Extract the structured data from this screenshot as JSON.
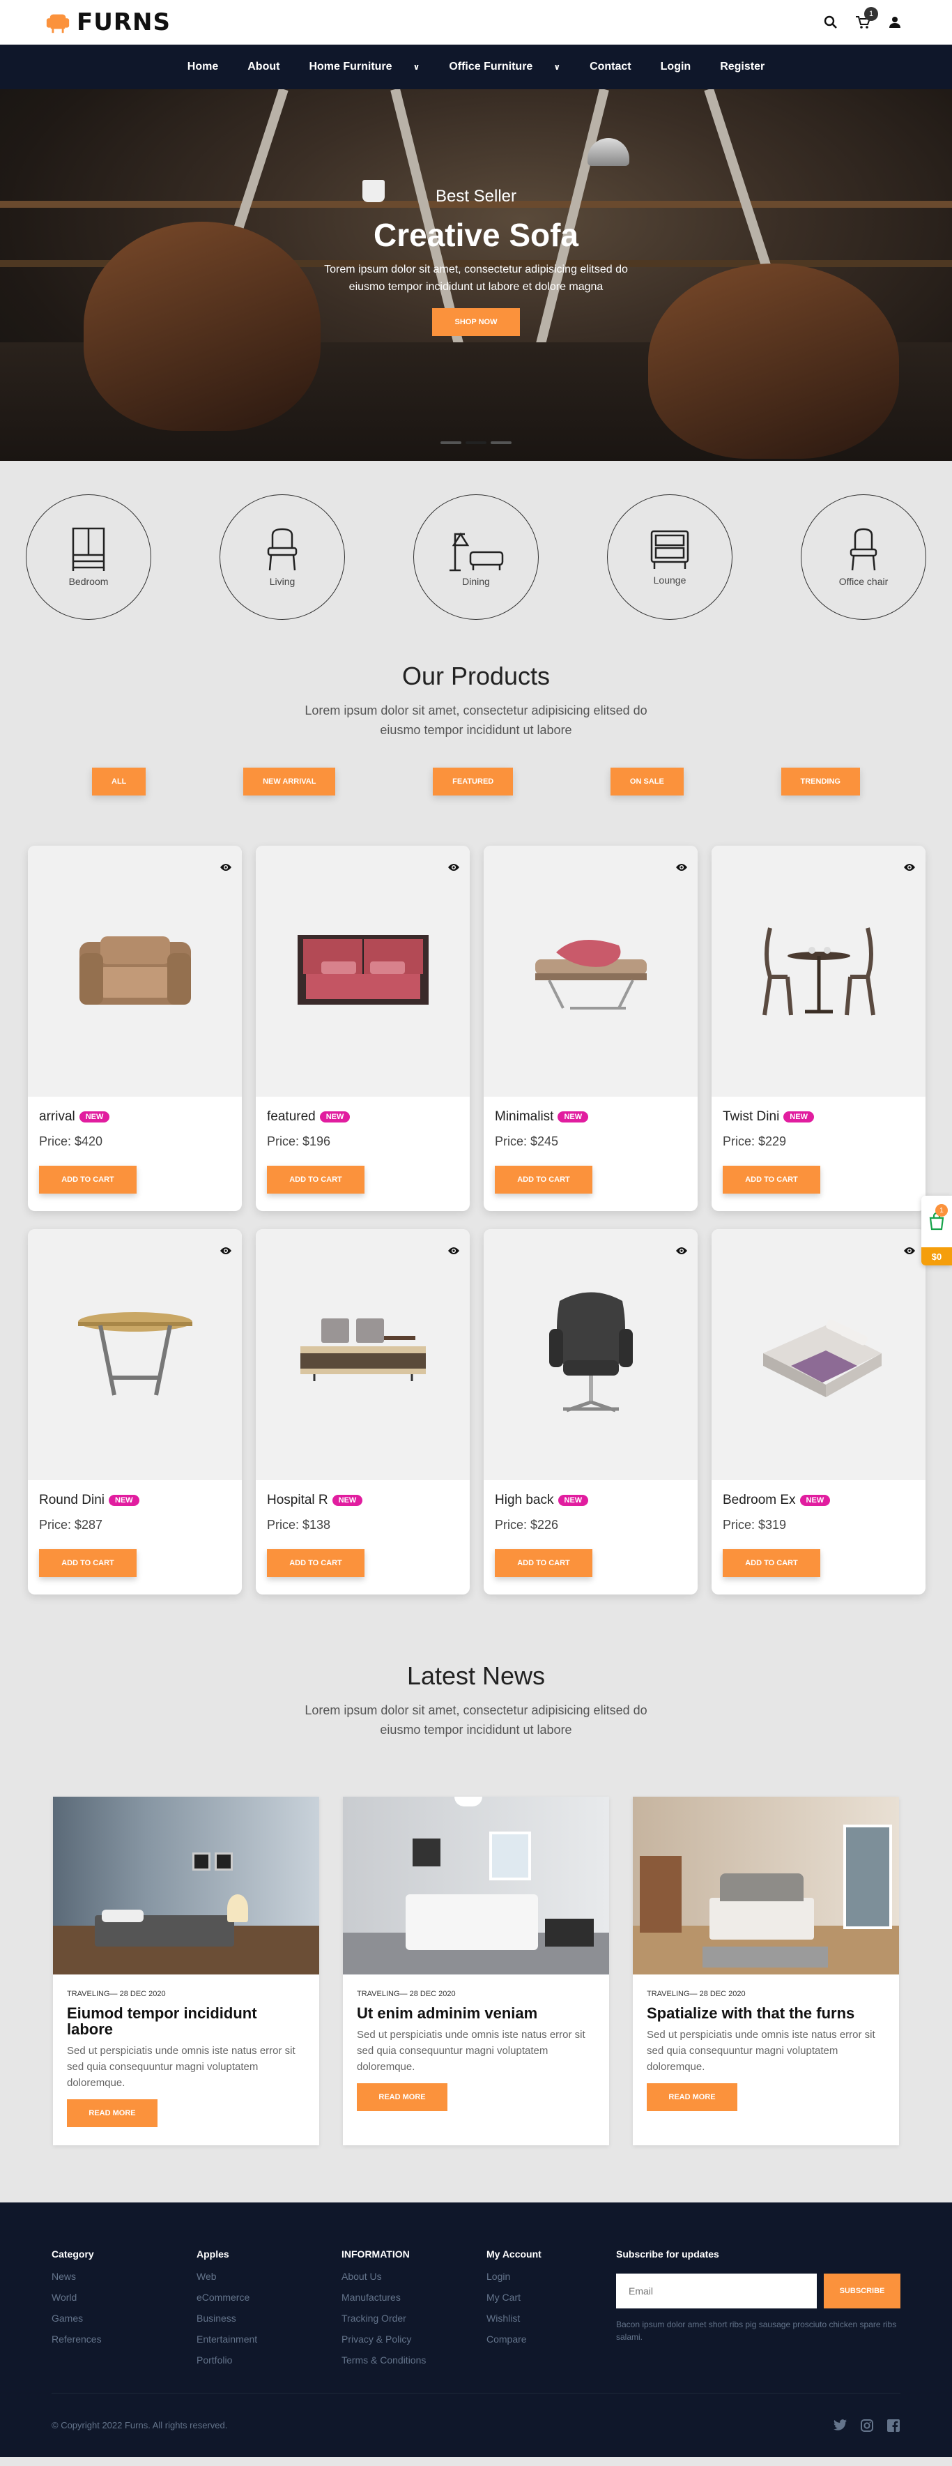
{
  "brand": {
    "name": "FURNS"
  },
  "header": {
    "cart_count": "1"
  },
  "nav": [
    {
      "label": "Home",
      "dropdown": false
    },
    {
      "label": "About",
      "dropdown": false
    },
    {
      "label": "Home Furniture",
      "dropdown": true
    },
    {
      "label": "Office Furniture",
      "dropdown": true
    },
    {
      "label": "Contact",
      "dropdown": false
    },
    {
      "label": "Login",
      "dropdown": false
    },
    {
      "label": "Register",
      "dropdown": false
    }
  ],
  "hero": {
    "subtitle": "Best Seller",
    "title": "Creative Sofa",
    "desc_line1": "Torem ipsum dolor sit amet, consectetur adipisicing elitsed do",
    "desc_line2": "eiusmo tempor incididunt ut labore et dolore magna",
    "button": "SHOP NOW"
  },
  "categories": [
    {
      "label": "Bedroom",
      "icon": "wardrobe-icon"
    },
    {
      "label": "Living",
      "icon": "armchair-icon"
    },
    {
      "label": "Dining",
      "icon": "lamp-sofa-icon"
    },
    {
      "label": "Lounge",
      "icon": "nightstand-icon"
    },
    {
      "label": "Office chair",
      "icon": "office-chair-icon"
    }
  ],
  "products_section": {
    "title": "Our Products",
    "desc_line1": "Lorem ipsum dolor sit amet, consectetur adipisicing elitsed do",
    "desc_line2": "eiusmo tempor incididunt ut labore"
  },
  "filters": [
    "ALL",
    "NEW ARRIVAL",
    "FEATURED",
    "ON SALE",
    "TRENDING"
  ],
  "product_labels": {
    "badge": "NEW",
    "add_to_cart": "ADD TO CART"
  },
  "products": [
    {
      "name": "arrival",
      "price": "Price: $420",
      "image": "armchair"
    },
    {
      "name": "featured",
      "price": "Price: $196",
      "image": "bed"
    },
    {
      "name": "Minimalist",
      "price": "Price: $245",
      "image": "lounger"
    },
    {
      "name": "Twist Dini",
      "price": "Price: $229",
      "image": "dining-set"
    },
    {
      "name": "Round Dini",
      "price": "Price: $287",
      "image": "round-table"
    },
    {
      "name": "Hospital R",
      "price": "Price: $138",
      "image": "tv-stand"
    },
    {
      "name": "High back",
      "price": "Price: $226",
      "image": "office-chair"
    },
    {
      "name": "Bedroom Ex",
      "price": "Price: $319",
      "image": "bed-set"
    }
  ],
  "floating_cart": {
    "count": "1",
    "total": "$0"
  },
  "news_section": {
    "title": "Latest News",
    "desc_line1": "Lorem ipsum dolor sit amet, consectetur adipisicing elitsed do",
    "desc_line2": "eiusmo tempor incididunt ut labore"
  },
  "news": [
    {
      "meta": "TRAVELING— 28 DEC 2020",
      "title": "Eiumod tempor incididunt labore",
      "text": "Sed ut perspiciatis unde omnis iste natus error sit sed quia consequuntur magni voluptatem doloremque.",
      "button": "READ MORE"
    },
    {
      "meta": "TRAVELING— 28 DEC 2020",
      "title": "Ut enim adminim veniam",
      "text": "Sed ut perspiciatis unde omnis iste natus error sit sed quia consequuntur magni voluptatem doloremque.",
      "button": "READ MORE"
    },
    {
      "meta": "TRAVELING— 28 DEC 2020",
      "title": "Spatialize with that the furns",
      "text": "Sed ut perspiciatis unde omnis iste natus error sit sed quia consequuntur magni voluptatem doloremque.",
      "button": "READ MORE"
    }
  ],
  "footer": {
    "columns": [
      {
        "title": "Category",
        "links": [
          "News",
          "World",
          "Games",
          "References"
        ]
      },
      {
        "title": "Apples",
        "links": [
          "Web",
          "eCommerce",
          "Business",
          "Entertainment",
          "Portfolio"
        ]
      },
      {
        "title": "INFORMATION",
        "links": [
          "About Us",
          "Manufactures",
          "Tracking Order",
          "Privacy & Policy",
          "Terms & Conditions"
        ]
      },
      {
        "title": "My Account",
        "links": [
          "Login",
          "My Cart",
          "Wishlist",
          "Compare"
        ]
      }
    ],
    "subscribe": {
      "title": "Subscribe for updates",
      "placeholder": "Email",
      "button": "SUBSCRIBE",
      "note": "Bacon ipsum dolor amet short ribs pig sausage prosciuto chicken spare ribs salami."
    },
    "copyright": "© Copyright 2022 Furns. All rights reserved.",
    "socials": [
      "twitter-icon",
      "instagram-icon",
      "facebook-icon"
    ]
  },
  "colors": {
    "accent": "#fb923c",
    "nav_bg": "#0f172a",
    "badge": "#e11d9f"
  }
}
